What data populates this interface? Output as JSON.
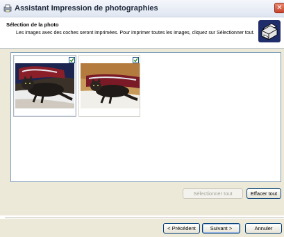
{
  "window": {
    "title": "Assistant Impression de photographies",
    "close_glyph": "✕",
    "icon": "printer-photo-icon"
  },
  "header": {
    "title": "Sélection de la photo",
    "description": "Les images avec des coches seront imprimées. Pour imprimer toutes les images, cliquez sur Sélectionner tout.",
    "icon": "printer-icon"
  },
  "photos": [
    {
      "selected": true,
      "checked": true,
      "icon": "cat-photo"
    },
    {
      "selected": false,
      "checked": true,
      "icon": "cat-photo"
    }
  ],
  "buttons": {
    "select_all": "Sélectionner tout",
    "clear_all": "Effacer tout",
    "back": "< Précédent",
    "next": "Suivant >",
    "cancel": "Annuler"
  },
  "colors": {
    "accent": "#003c74",
    "close": "#c8432a",
    "checkmark": "#2f8f2f",
    "panel": "#ece9d8"
  }
}
